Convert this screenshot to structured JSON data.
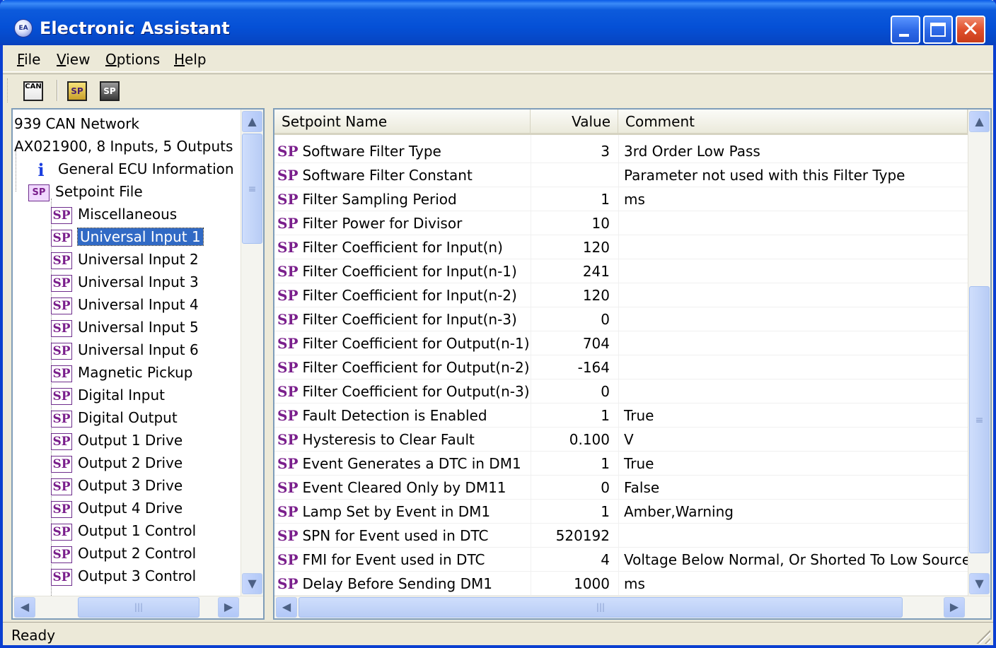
{
  "window": {
    "title": "Electronic Assistant",
    "app_icon": "ea-logo-icon"
  },
  "menu": {
    "items": [
      "File",
      "View",
      "Options",
      "Help"
    ]
  },
  "toolbar": {
    "buttons": [
      {
        "name": "can-connect-button",
        "label": "CAN"
      },
      {
        "name": "open-setpoint-button",
        "label": "SP"
      },
      {
        "name": "save-setpoint-button",
        "label": "SP"
      }
    ]
  },
  "tree": {
    "root": "939 CAN Network",
    "device": "AX021900, 8 Inputs, 5 Outputs",
    "general": "General ECU Information",
    "setpoint_file": "Setpoint File",
    "setpoint_folder_badge": "SP",
    "sp_badge": "SP",
    "items": [
      "Miscellaneous",
      "Universal Input 1",
      "Universal Input 2",
      "Universal Input 3",
      "Universal Input 4",
      "Universal Input 5",
      "Universal Input 6",
      "Magnetic Pickup",
      "Digital Input",
      "Digital Output",
      "Output 1 Drive",
      "Output 2 Drive",
      "Output 3 Drive",
      "Output 4 Drive",
      "Output 1 Control",
      "Output 2 Control",
      "Output 3 Control"
    ],
    "selected": "Universal Input 1"
  },
  "list": {
    "headers": {
      "name": "Setpoint Name",
      "value": "Value",
      "comment": "Comment"
    },
    "sp_tag": "SP",
    "rows": [
      {
        "name": "Software Filter Type",
        "value": "3",
        "comment": "3rd Order Low Pass"
      },
      {
        "name": "Software Filter Constant",
        "value": "",
        "comment": "Parameter not used with this Filter Type"
      },
      {
        "name": "Filter Sampling Period",
        "value": "1",
        "comment": "ms"
      },
      {
        "name": "Filter Power for Divisor",
        "value": "10",
        "comment": ""
      },
      {
        "name": "Filter Coefficient for Input(n)",
        "value": "120",
        "comment": ""
      },
      {
        "name": "Filter Coefficient for Input(n-1)",
        "value": "241",
        "comment": ""
      },
      {
        "name": "Filter Coefficient for Input(n-2)",
        "value": "120",
        "comment": ""
      },
      {
        "name": "Filter Coefficient for Input(n-3)",
        "value": "0",
        "comment": ""
      },
      {
        "name": "Filter Coefficient for Output(n-1)",
        "value": "704",
        "comment": ""
      },
      {
        "name": "Filter Coefficient for Output(n-2)",
        "value": "-164",
        "comment": ""
      },
      {
        "name": "Filter Coefficient for Output(n-3)",
        "value": "0",
        "comment": ""
      },
      {
        "name": "Fault Detection is Enabled",
        "value": "1",
        "comment": "True"
      },
      {
        "name": "Hysteresis to Clear Fault",
        "value": "0.100",
        "comment": "V"
      },
      {
        "name": "Event Generates a DTC in DM1",
        "value": "1",
        "comment": "True"
      },
      {
        "name": "Event Cleared Only by DM11",
        "value": "0",
        "comment": "False"
      },
      {
        "name": "Lamp Set by Event in DM1",
        "value": "1",
        "comment": "Amber,Warning"
      },
      {
        "name": "SPN for Event used in DTC",
        "value": "520192",
        "comment": ""
      },
      {
        "name": "FMI for Event used in DTC",
        "value": "4",
        "comment": "Voltage Below Normal, Or Shorted To Low Source"
      },
      {
        "name": "Delay Before Sending DM1",
        "value": "1000",
        "comment": "ms"
      }
    ]
  },
  "status": {
    "text": "Ready"
  },
  "colors": {
    "titlebar": "#0550d6",
    "selection": "#316ac5",
    "sp_purple": "#7a1f8c",
    "info_blue": "#1a3ee0"
  }
}
